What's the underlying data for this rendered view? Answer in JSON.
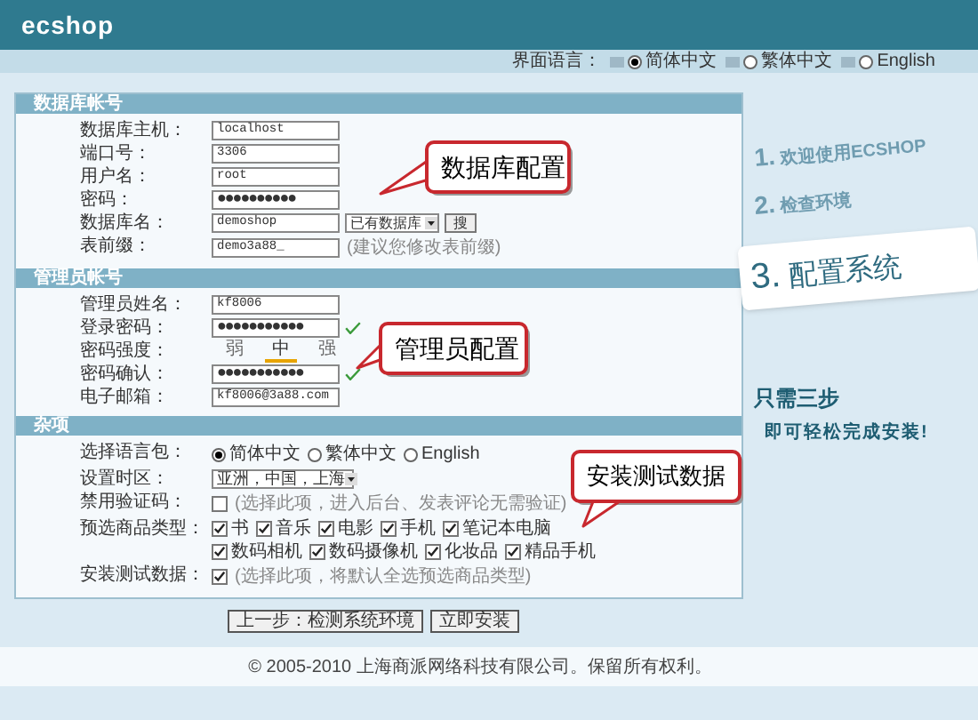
{
  "header": {
    "logo": "ecshop"
  },
  "language_bar": {
    "label": "界面语言：",
    "options": [
      {
        "label": "简体中文",
        "selected": true
      },
      {
        "label": "繁体中文",
        "selected": false
      },
      {
        "label": "English",
        "selected": false
      }
    ]
  },
  "sections": [
    {
      "title": "数据库帐号",
      "rows": [
        {
          "kind": "text",
          "label": "数据库主机：",
          "value": "localhost"
        },
        {
          "kind": "text",
          "label": "端口号：",
          "value": "3306"
        },
        {
          "kind": "text",
          "label": "用户名：",
          "value": "root"
        },
        {
          "kind": "password",
          "label": "密码：",
          "value": "●●●●●●●●●●"
        },
        {
          "kind": "dbname",
          "label": "数据库名：",
          "value": "demoshop",
          "select": "已有数据库",
          "button": "搜"
        },
        {
          "kind": "hinted",
          "label": "表前缀：",
          "value": "demo3a88_",
          "hint": "(建议您修改表前缀)"
        }
      ]
    },
    {
      "title": "管理员帐号",
      "rows": [
        {
          "kind": "text",
          "label": "管理员姓名：",
          "value": "kf8006"
        },
        {
          "kind": "password",
          "label": "登录密码：",
          "value": "●●●●●●●●●●●",
          "valid": true
        },
        {
          "kind": "strength",
          "label": "密码强度：",
          "levels": [
            {
              "label": "弱",
              "selected": false
            },
            {
              "label": "中",
              "selected": true
            },
            {
              "label": "强",
              "selected": false
            }
          ]
        },
        {
          "kind": "password",
          "label": "密码确认：",
          "value": "●●●●●●●●●●●",
          "valid": true
        },
        {
          "kind": "text",
          "label": "电子邮箱：",
          "value": "kf8006@3a88.com"
        }
      ]
    },
    {
      "title": "杂项",
      "rows": [
        {
          "kind": "radios",
          "label": "选择语言包：",
          "options": [
            {
              "label": "简体中文",
              "selected": true
            },
            {
              "label": "繁体中文",
              "selected": false
            },
            {
              "label": "English",
              "selected": false
            }
          ]
        },
        {
          "kind": "select",
          "label": "设置时区：",
          "value": "亚洲，中国，上海"
        },
        {
          "kind": "checkbox",
          "label": "禁用验证码：",
          "checked": false,
          "hint": "(选择此项，进入后台、发表评论无需验证)"
        },
        {
          "kind": "checkgroup",
          "label": "预选商品类型：",
          "lines": [
            [
              {
                "label": "书",
                "checked": true
              },
              {
                "label": "音乐",
                "checked": true
              },
              {
                "label": "电影",
                "checked": true
              },
              {
                "label": "手机",
                "checked": true
              },
              {
                "label": "笔记本电脑",
                "checked": true
              }
            ],
            [
              {
                "label": "数码相机",
                "checked": true
              },
              {
                "label": "数码摄像机",
                "checked": true
              },
              {
                "label": "化妆品",
                "checked": true
              },
              {
                "label": "精品手机",
                "checked": true
              }
            ]
          ]
        },
        {
          "kind": "checkbox",
          "label": "安装测试数据：",
          "checked": true,
          "hint": "(选择此项，将默认全选预选商品类型)"
        }
      ]
    }
  ],
  "callouts": [
    {
      "text": "数据库配置"
    },
    {
      "text": "管理员配置"
    },
    {
      "text": "安装测试数据"
    }
  ],
  "steps": [
    {
      "number": "1.",
      "label": "欢迎使用ECSHOP",
      "selected": false
    },
    {
      "number": "2.",
      "label": "检查环境",
      "selected": false
    },
    {
      "number": "3.",
      "label": "配置系统",
      "selected": true
    }
  ],
  "tagline": [
    "只需三步",
    "即可轻松完成安装!"
  ],
  "buttons": [
    "上一步：检测系统环境",
    "立即安装"
  ],
  "footer": "© 2005-2010 上海商派网络科技有限公司。保留所有权利。"
}
